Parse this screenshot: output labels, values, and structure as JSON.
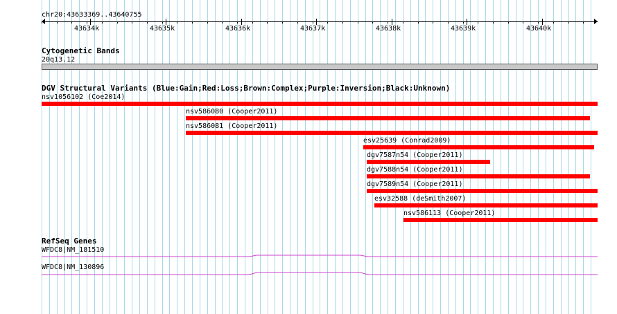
{
  "ruler": {
    "position": "chr20:43633369..43640755",
    "ticks": [
      "43634k",
      "43635k",
      "43636k",
      "43637k",
      "43638k",
      "43639k",
      "43640k"
    ]
  },
  "cytoband": {
    "title": "Cytogenetic Bands",
    "band": "20q13.12"
  },
  "dgv": {
    "title": "DGV Structural Variants (Blue:Gain;Red:Loss;Brown:Complex;Purple:Inversion;Black:Unknown)",
    "color": "#ff0000",
    "variants": [
      {
        "label": "nsv1056102 (Coe2014)"
      },
      {
        "label": "nsv586080 (Cooper2011)"
      },
      {
        "label": "nsv586081 (Cooper2011)"
      },
      {
        "label": "esv25639 (Conrad2009)"
      },
      {
        "label": "dgv7587n54 (Cooper2011)"
      },
      {
        "label": "dgv7588n54 (Cooper2011)"
      },
      {
        "label": "dgv7589n54 (Cooper2011)"
      },
      {
        "label": "esv32588 (deSmith2007)"
      },
      {
        "label": "nsv586113 (Cooper2011)"
      }
    ]
  },
  "refseq": {
    "title": "RefSeq Genes",
    "color": "#cc44cc",
    "genes": [
      {
        "label": "WFDC8|NM_181510"
      },
      {
        "label": "WFDC8|NM_130896"
      }
    ]
  },
  "colors": {
    "grid": "#a8d8e8",
    "variant_loss": "#ff0000",
    "gene": "#cc44cc"
  }
}
